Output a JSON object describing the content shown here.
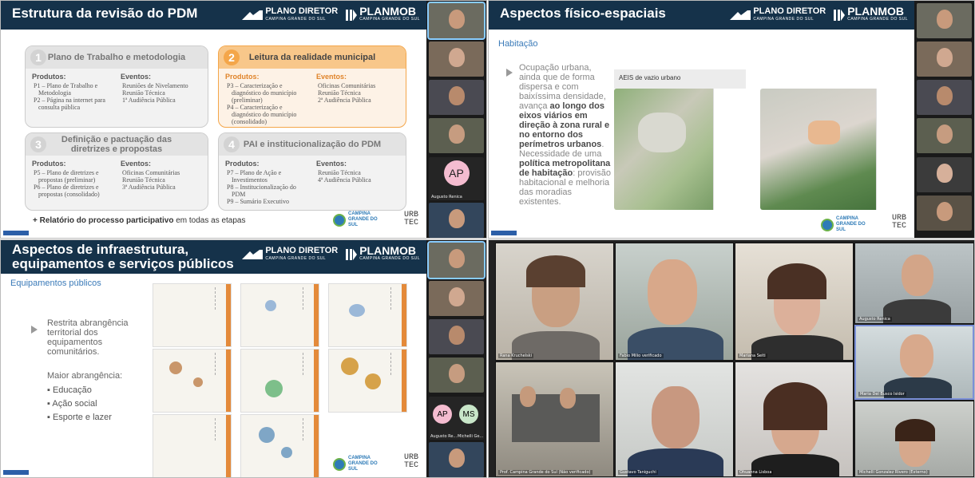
{
  "q1": {
    "title": "Estrutura da revisão do PDM",
    "logo1": "PLANO DIRETOR",
    "logo1_sub": "CAMPINA GRANDE DO SUL",
    "logo2": "PLANMOB",
    "logo2_sub": "CAMPINA GRANDE DO SUL",
    "cards": [
      {
        "num": "1",
        "title": "Plano de Trabalho e metodologia",
        "products_label": "Produtos:",
        "products": [
          "P1 – Plano de Trabalho e Metodologia",
          "P2 – Página na internet para consulta pública"
        ],
        "events_label": "Eventos:",
        "events": [
          "Reuniões de Nivelamento",
          "Reunião Técnica",
          "1ª Audiência Pública"
        ]
      },
      {
        "num": "2",
        "title": "Leitura da realidade municipal",
        "products_label": "Produtos:",
        "products": [
          "P3 – Caracterização e diagnóstico do município (preliminar)",
          "P4 – Caracterização e diagnóstico do município (consolidado)"
        ],
        "events_label": "Eventos:",
        "events": [
          "Oficinas Comunitárias",
          "Reunião Técnica",
          "2ª Audiência Pública"
        ]
      },
      {
        "num": "3",
        "title": "Definição e pactuação das diretrizes e propostas",
        "products_label": "Produtos:",
        "products": [
          "P5 – Plano de diretrizes e propostas (preliminar)",
          "P6 – Plano de diretrizes e propostas (consolidado)"
        ],
        "events_label": "Eventos:",
        "events": [
          "Oficinas Comunitárias",
          "Reunião Técnica",
          "3ª Audiência Pública"
        ]
      },
      {
        "num": "4",
        "title": "PAI e institucionalização do PDM",
        "products_label": "Produtos:",
        "products": [
          "P7 – Plano de Ação e Investimentos",
          "P8 – Institucionalização do PDM",
          "P9 – Sumário Executivo"
        ],
        "events_label": "Eventos:",
        "events": [
          "Reunião Técnica",
          "4ª Audiência Pública"
        ]
      }
    ],
    "footer_bold": "+ Relatório do processo participativo",
    "footer_rest": " em todas as etapas",
    "seal": "CAMPINA GRANDE DO SUL",
    "urb": "URB",
    "tec": "TEC",
    "strip": {
      "avatar": "AP",
      "avatar_name": "Augusto Renica"
    }
  },
  "q2": {
    "title": "Aspectos físico-espaciais",
    "subtitle": "Habitação",
    "p1_plain": "Ocupação urbana, ainda que de forma dispersa e com baixíssima densidade, avança ",
    "p1_bold": "ao longo dos eixos viários em direção à zona rural e no entorno dos perímetros urbanos",
    "p1_end": ".",
    "p2_plain": "Necessidade de uma ",
    "p2_bold": "política metropolitana de habitação",
    "p2_end": ": provisão habitacional e melhoria das moradias existentes.",
    "map_label": "AEIS de vazio urbano",
    "seal": "CAMPINA GRANDE DO SUL",
    "urb": "URB",
    "tec": "TEC"
  },
  "q3": {
    "title": "Aspectos de infraestrutura, equipamentos e serviços públicos",
    "subtitle": "Equipamentos públicos",
    "p1": "Restrita abrangência territorial dos equipamentos comunitários.",
    "p2": "Maior abrangência:",
    "bullets": [
      "Educação",
      "Ação social",
      "Esporte e lazer"
    ],
    "seal": "CAMPINA GRANDE DO SUL",
    "urb": "URB",
    "tec": "TEC",
    "strip": {
      "a1": "AP",
      "a1_name": "Augusto Re...",
      "a2": "MS",
      "a2_name": "Michelli Ge..."
    }
  },
  "q4": {
    "participants": [
      "Rana Kruchelski",
      "Fabio Milio verificado",
      "Mariana Seiti",
      "Augusto Renica",
      "Maria Del Busco Isidor",
      "Prof. Campina Grande do Sul (Não verificado)",
      "Gustavo Taniguchi",
      "Ohuanna Lisboa",
      "Michelli Gonzalez Rivero (Externo)"
    ]
  },
  "colors": {
    "header": "#15324a",
    "card_gray": "#ebebeb",
    "card_orange": "#f4a64a",
    "accent_blue": "#3a7ab8"
  }
}
